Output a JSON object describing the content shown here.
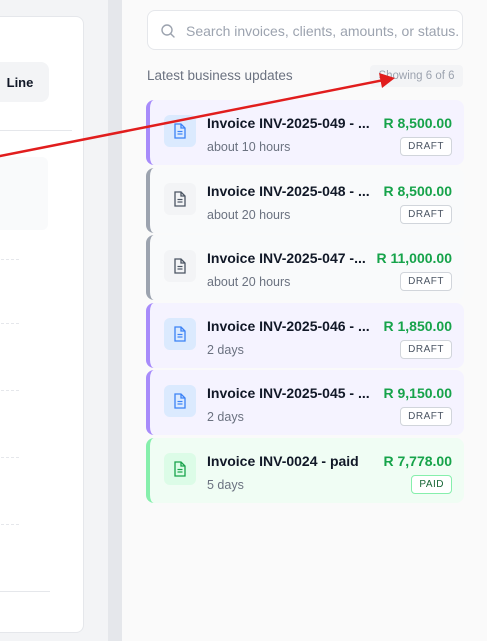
{
  "left_card": {
    "toggle_line_label": "Line"
  },
  "search": {
    "placeholder": "Search invoices, clients, amounts, or status..."
  },
  "updates": {
    "title": "Latest business updates",
    "count_label": "Showing 6 of 6",
    "items": [
      {
        "title": "Invoice INV-2025-049 - ...",
        "time": "about 10 hours",
        "amount": "R 8,500.00",
        "status": "DRAFT",
        "icon": "document-icon"
      },
      {
        "title": "Invoice INV-2025-048 - ...",
        "time": "about 20 hours",
        "amount": "R 8,500.00",
        "status": "DRAFT",
        "icon": "document-icon"
      },
      {
        "title": "Invoice INV-2025-047 -...",
        "time": "about 20 hours",
        "amount": "R 11,000.00",
        "status": "DRAFT",
        "icon": "document-icon"
      },
      {
        "title": "Invoice INV-2025-046 - ...",
        "time": "2 days",
        "amount": "R 1,850.00",
        "status": "DRAFT",
        "icon": "document-icon"
      },
      {
        "title": "Invoice INV-2025-045 - ...",
        "time": "2 days",
        "amount": "R 9,150.00",
        "status": "DRAFT",
        "icon": "document-icon"
      },
      {
        "title": "Invoice INV-0024 - paid",
        "time": "5 days",
        "amount": "R 7,778.00",
        "status": "PAID",
        "icon": "document-icon"
      }
    ]
  },
  "colors": {
    "amount_green": "#16a34a",
    "draft_purple_border": "#a78bfa",
    "draft_gray_border": "#9ca3af",
    "paid_green_border": "#86efac",
    "annotation_arrow": "#e11d1d"
  }
}
